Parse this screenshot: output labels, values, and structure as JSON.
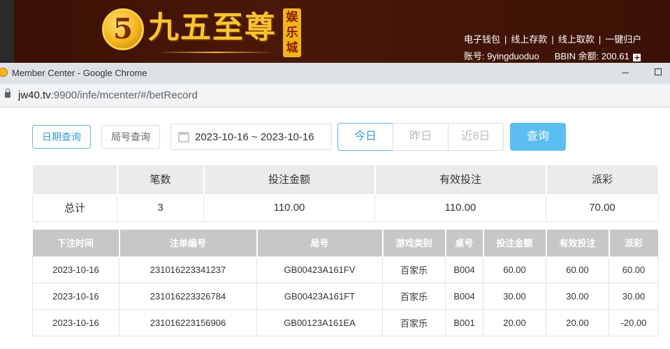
{
  "site": {
    "logo_char": "5",
    "logo_text": "九五至尊",
    "badge": [
      "娱",
      "乐",
      "城"
    ],
    "links": [
      "电子钱包",
      "线上存款",
      "线上取款",
      "一键归户"
    ],
    "account_label": "账号:",
    "account_value": "9yingduoduo",
    "balance_label": "BBIN 余额:",
    "balance_value": "200.61",
    "plus_icon": "+"
  },
  "browser": {
    "title": "Member Center - Google Chrome",
    "url_host": "jw40.tv",
    "url_path": ":9900/infe/mcenter/#/betRecord"
  },
  "filters": {
    "date_query": "日期查询",
    "round_query": "局号查询",
    "date_range": "2023-10-16 ~ 2023-10-16",
    "today": "今日",
    "yesterday": "昨日",
    "last8": "近8日",
    "query": "查询"
  },
  "summary": {
    "headers": [
      "",
      "笔数",
      "投注金额",
      "有效投注",
      "派彩"
    ],
    "row": [
      "总计",
      "3",
      "110.00",
      "110.00",
      "70.00"
    ]
  },
  "records": {
    "headers": [
      "下注时间",
      "注单编号",
      "局号",
      "游戏类别",
      "桌号",
      "投注金额",
      "有效投注",
      "派彩"
    ],
    "rows": [
      [
        "2023-10-16",
        "231016223341237",
        "GB00423A161FV",
        "百家乐",
        "B004",
        "60.00",
        "60.00",
        "60.00"
      ],
      [
        "2023-10-16",
        "231016223326784",
        "GB00423A161FT",
        "百家乐",
        "B004",
        "30.00",
        "30.00",
        "30.00"
      ],
      [
        "2023-10-16",
        "231016223156906",
        "GB00123A161EA",
        "百家乐",
        "B001",
        "20.00",
        "20.00",
        "-20.00"
      ]
    ]
  },
  "colors": {
    "accent": "#5ab4e0",
    "query_button": "#5cbdf0",
    "negative": "#e53935",
    "banner": "#3a0f05"
  }
}
